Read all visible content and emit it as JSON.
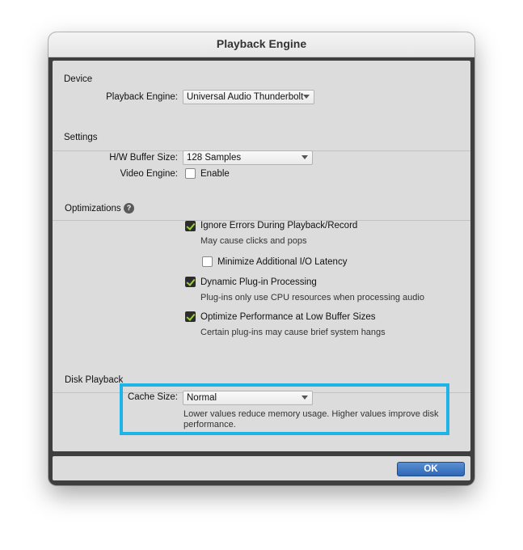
{
  "window": {
    "title": "Playback Engine"
  },
  "device": {
    "heading": "Device",
    "engine_label": "Playback Engine:",
    "engine_value": "Universal Audio Thunderbolt"
  },
  "settings": {
    "heading": "Settings",
    "buffer_label": "H/W Buffer Size:",
    "buffer_value": "128 Samples",
    "video_label": "Video Engine:",
    "video_enable_label": "Enable",
    "video_enabled": false
  },
  "optimizations": {
    "heading": "Optimizations",
    "help_icon": "?",
    "items": [
      {
        "label": "Ignore Errors During Playback/Record",
        "note": "May cause clicks and pops",
        "checked": true
      },
      {
        "label": "Minimize Additional I/O Latency",
        "note": "",
        "checked": false
      },
      {
        "label": "Dynamic Plug-in Processing",
        "note": "Plug-ins only use CPU resources when processing audio",
        "checked": true
      },
      {
        "label": "Optimize Performance at Low Buffer Sizes",
        "note": "Certain plug-ins may cause brief system hangs",
        "checked": true
      }
    ]
  },
  "disk_playback": {
    "heading": "Disk Playback",
    "cache_label": "Cache Size:",
    "cache_value": "Normal",
    "note_line1": "Lower values reduce memory usage. Higher values improve disk",
    "note_line2": "performance."
  },
  "footer": {
    "ok_label": "OK"
  },
  "colors": {
    "highlight": "#1fb4e6",
    "ok_button": "#3a74c4",
    "checkmark": "#9ad23b"
  }
}
